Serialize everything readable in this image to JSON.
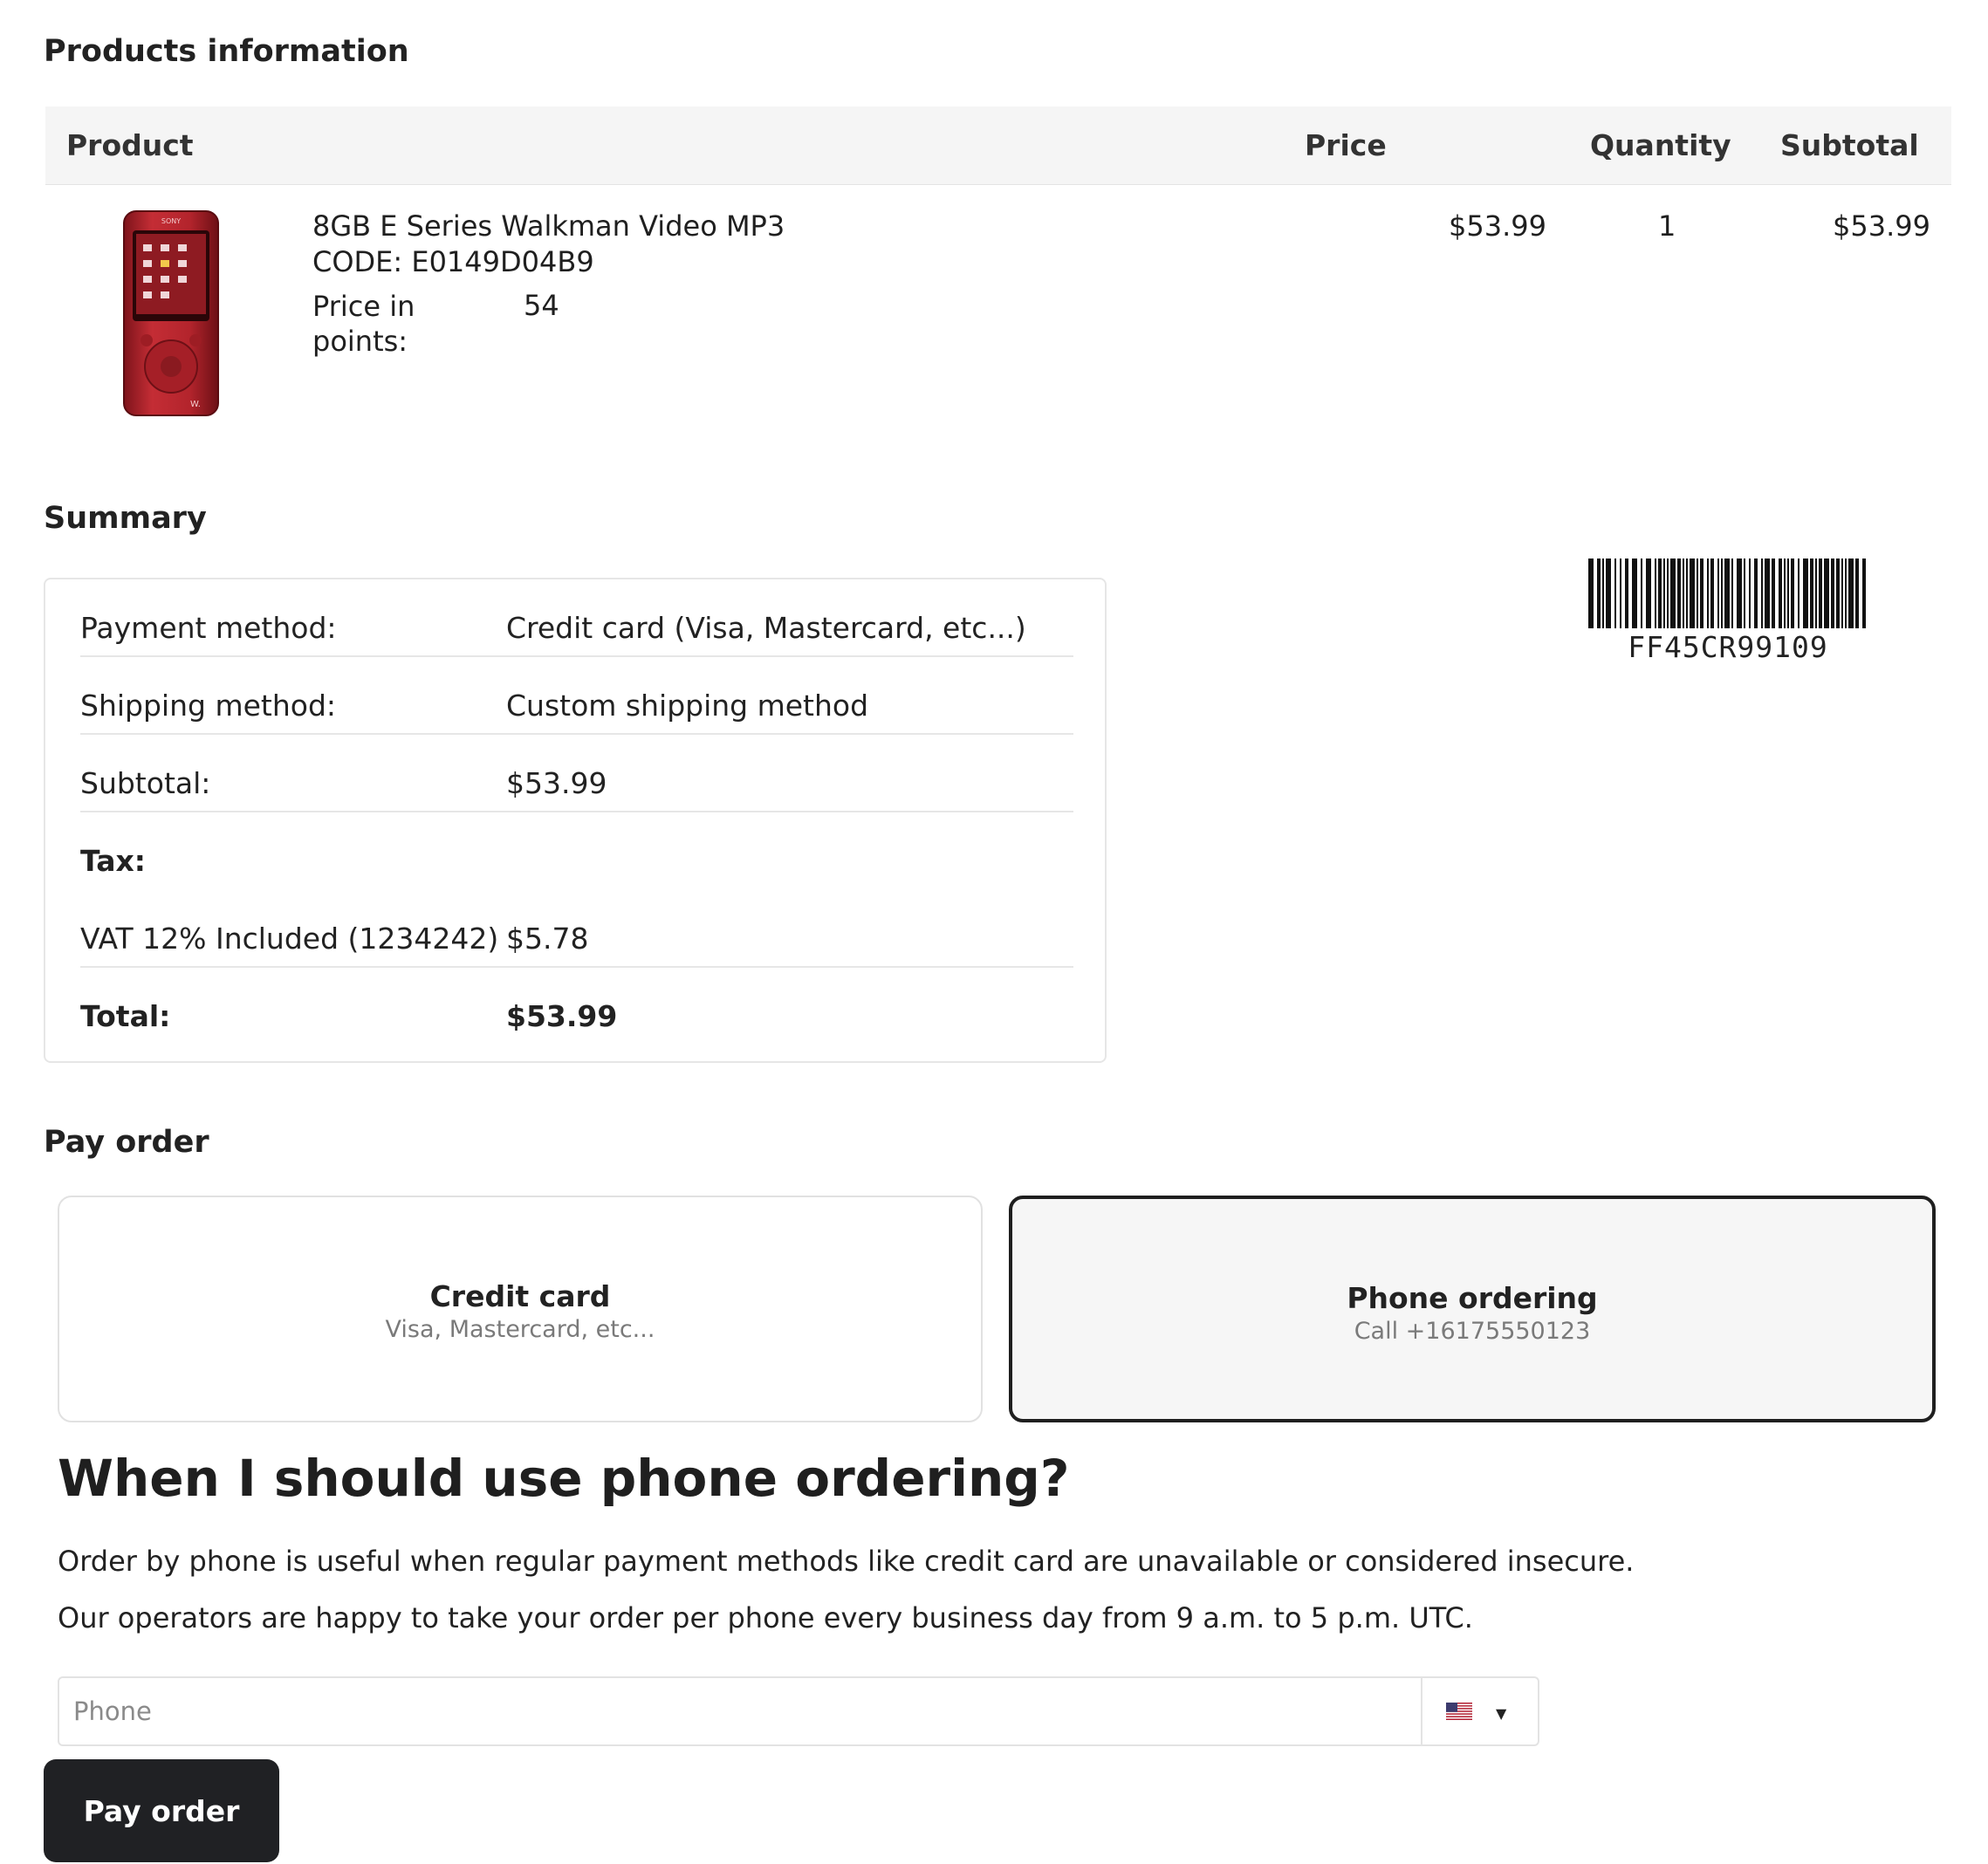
{
  "products_section": {
    "title": "Products information",
    "headers": {
      "product": "Product",
      "price": "Price",
      "quantity": "Quantity",
      "subtotal": "Subtotal"
    },
    "items": [
      {
        "name": "8GB E Series Walkman Video MP3",
        "code": "CODE: E0149D04B9",
        "points_label": "Price in points:",
        "points_value": "54",
        "price": "$53.99",
        "quantity": "1",
        "subtotal": "$53.99",
        "image_icon": "red-mp3-player-image",
        "image_text": "SONY"
      }
    ]
  },
  "summary": {
    "title": "Summary",
    "payment_label": "Payment method:",
    "payment_value": "Credit card (Visa, Mastercard, etc...)",
    "shipping_label": "Shipping method:",
    "shipping_value": "Custom shipping method",
    "subtotal_label": "Subtotal:",
    "subtotal_value": "$53.99",
    "tax_label": "Tax:",
    "vat_label": "VAT 12% Included (1234242)",
    "vat_value": "$5.78",
    "total_label": "Total:",
    "total_value": "$53.99"
  },
  "barcode": {
    "text": "FF45CR99109"
  },
  "pay_order": {
    "title": "Pay order",
    "options": [
      {
        "title": "Credit card",
        "subtitle": "Visa, Mastercard, etc...",
        "selected": false
      },
      {
        "title": "Phone ordering",
        "subtitle": "Call +16175550123",
        "selected": true
      }
    ],
    "info_heading": "When I should use phone ordering?",
    "info_paragraph_1": "Order by phone is useful when regular payment methods like credit card are unavailable or considered insecure.",
    "info_paragraph_2": "Our operators are happy to take your order per phone every business day from 9 a.m. to 5 p.m. UTC.",
    "phone_placeholder": "Phone",
    "phone_value": "",
    "country_flag": "us-flag-icon",
    "submit_label": "Pay order"
  },
  "colors": {
    "button_bg": "#202124",
    "selected_border": "#1f1f1f",
    "header_bg": "#f5f5f5",
    "product_red": "#b3242c"
  }
}
